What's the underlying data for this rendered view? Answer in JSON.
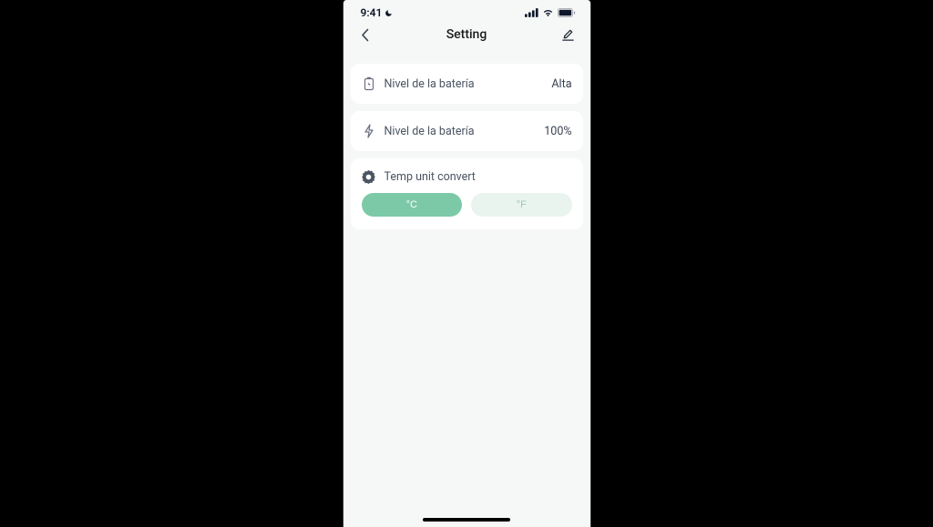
{
  "statusBar": {
    "time": "9:41"
  },
  "nav": {
    "title": "Setting"
  },
  "batteryLevel": {
    "label": "Nivel de la batería",
    "value": "Alta"
  },
  "batteryPercent": {
    "label": "Nivel de la batería",
    "value": "100%"
  },
  "tempUnit": {
    "label": "Temp unit convert",
    "celsius": "°C",
    "fahrenheit": "°F"
  }
}
